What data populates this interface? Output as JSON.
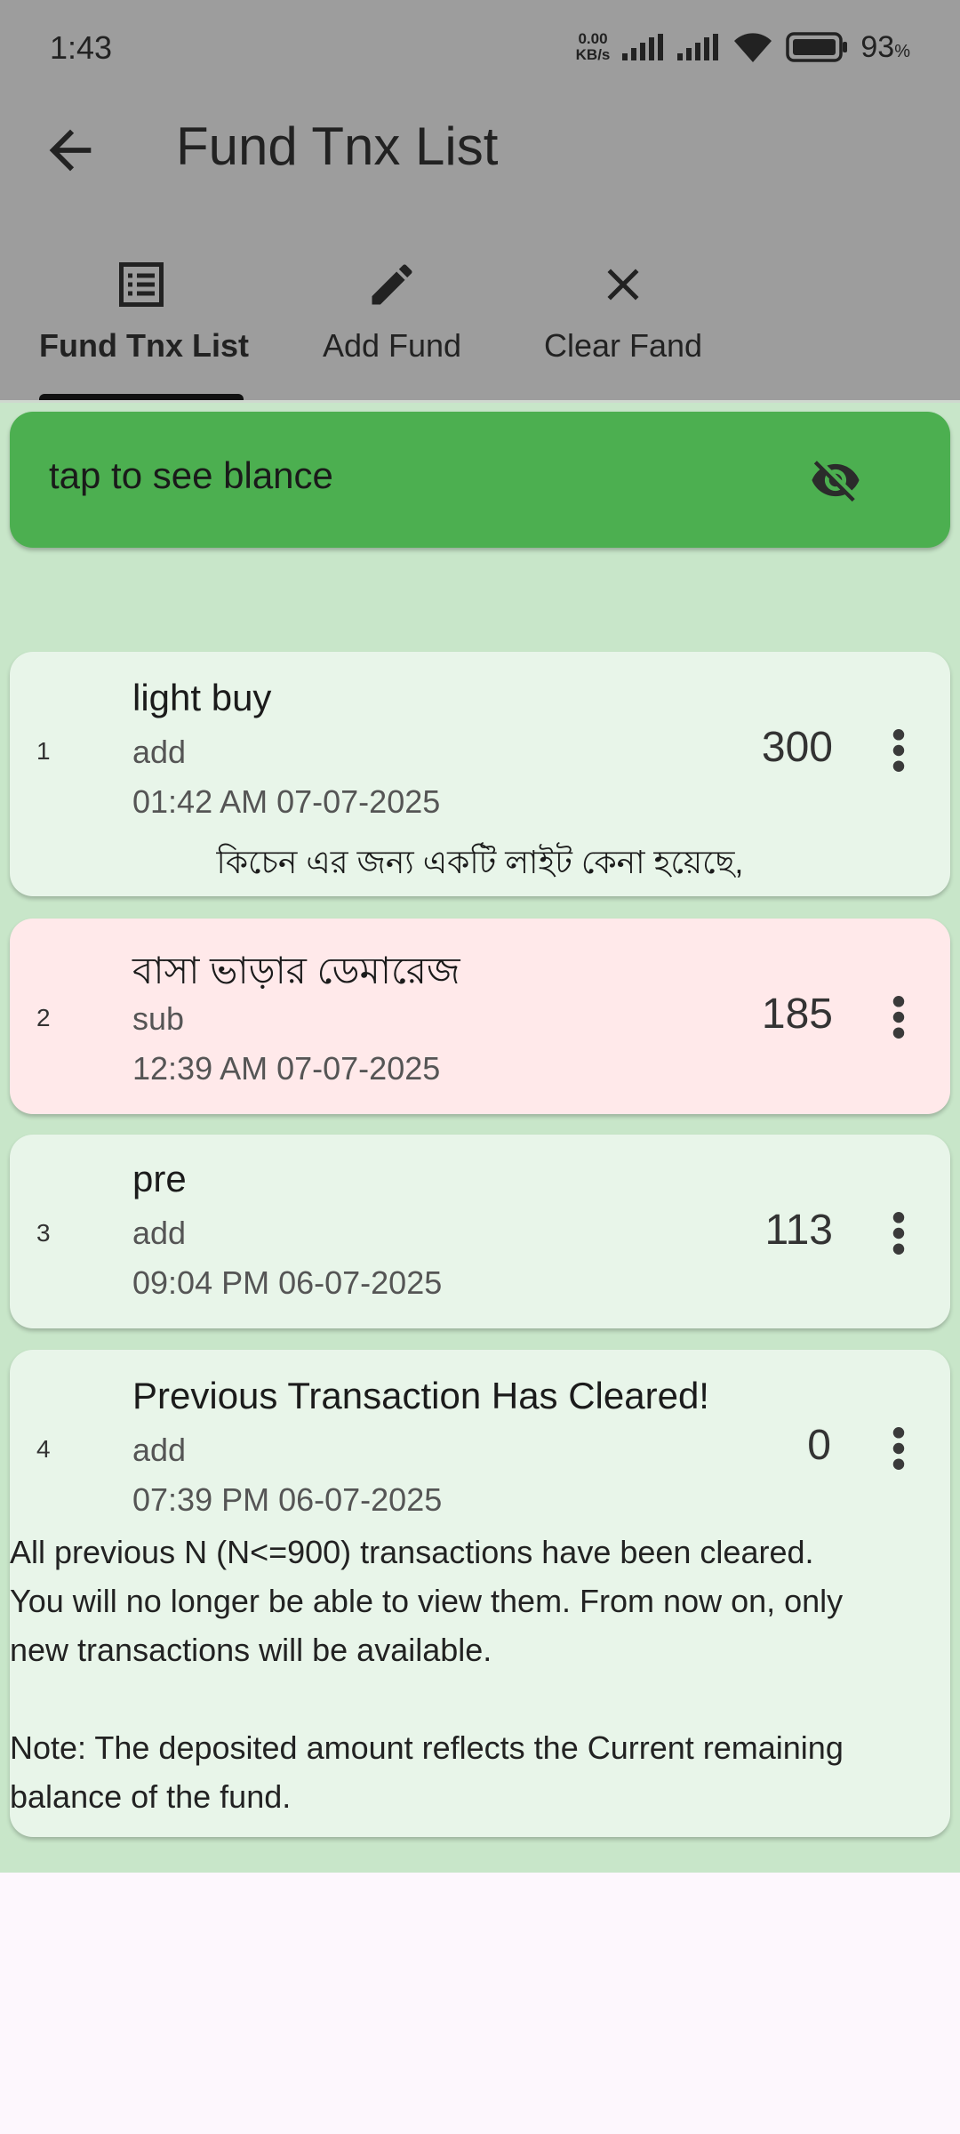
{
  "status_bar": {
    "time": "1:43",
    "speed_value": "0.00",
    "speed_unit": "KB/s",
    "battery_percent": "93",
    "battery_unit": "%"
  },
  "app_bar": {
    "title": "Fund Tnx List",
    "back_icon": "arrow-left-icon"
  },
  "tabs": [
    {
      "label": "Fund Tnx List",
      "icon": "list-icon",
      "active": true
    },
    {
      "label": "Add Fund",
      "icon": "pencil-icon",
      "active": false
    },
    {
      "label": "Clear Fand",
      "icon": "close-icon",
      "active": false
    }
  ],
  "balance": {
    "label": "tap to see blance",
    "icon": "eye-off-icon"
  },
  "transactions": [
    {
      "index": "1",
      "title": "light buy",
      "type": "add",
      "datetime": "01:42 AM 07-07-2025",
      "amount": "300",
      "note": "কিচেন এর জন্য একটি লাইট কেনা হয়েছে,"
    },
    {
      "index": "2",
      "title": " বাসা ভাড়ার ডেমারেজ",
      "type": "sub",
      "datetime": "12:39 AM 07-07-2025",
      "amount": "185"
    },
    {
      "index": "3",
      "title": "pre",
      "type": "add",
      "datetime": "09:04 PM 06-07-2025",
      "amount": "113"
    },
    {
      "index": "4",
      "title": "Previous Transaction Has Cleared!",
      "type": "add",
      "datetime": "07:39 PM 06-07-2025",
      "amount": "0",
      "description_line1": "All previous N (N<=900) transactions have been cleared.",
      "description_line2": "You will no longer be able to view them. From now on, only",
      "description_line3": "new transactions will be available.",
      "description_line4": "Note: The deposited amount reflects the Current remaining",
      "description_line5": "balance of the fund."
    }
  ],
  "colors": {
    "topbar": "#9d9d9d",
    "content_bg": "#c8e6c9",
    "balance_card": "#4caf50",
    "card_add": "#e8f5e9",
    "card_sub": "#ffe9ea"
  }
}
